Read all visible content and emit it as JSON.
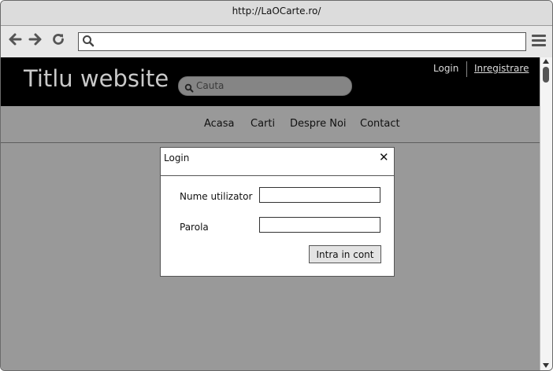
{
  "browser": {
    "url_title": "http://LaOCarte.ro/",
    "address_value": "",
    "icons": [
      "back-arrow-icon",
      "forward-arrow-icon",
      "reload-icon",
      "search-icon",
      "hamburger-menu-icon"
    ]
  },
  "site": {
    "title": "Titlu website",
    "search_placeholder": "Cauta",
    "login_link": "Login",
    "register_link": "Inregistrare",
    "nav": [
      "Acasa",
      "Carti",
      "Despre Noi",
      "Contact"
    ]
  },
  "login_modal": {
    "title": "Login",
    "close_glyph": "✕",
    "username_label": "Nume utilizator",
    "username_value": "",
    "password_label": "Parola",
    "password_value": "",
    "submit_label": "Intra in cont"
  },
  "colors": {
    "header_bg": "#000000",
    "page_bg": "#999999",
    "chrome_bg": "#dcdcdc"
  }
}
